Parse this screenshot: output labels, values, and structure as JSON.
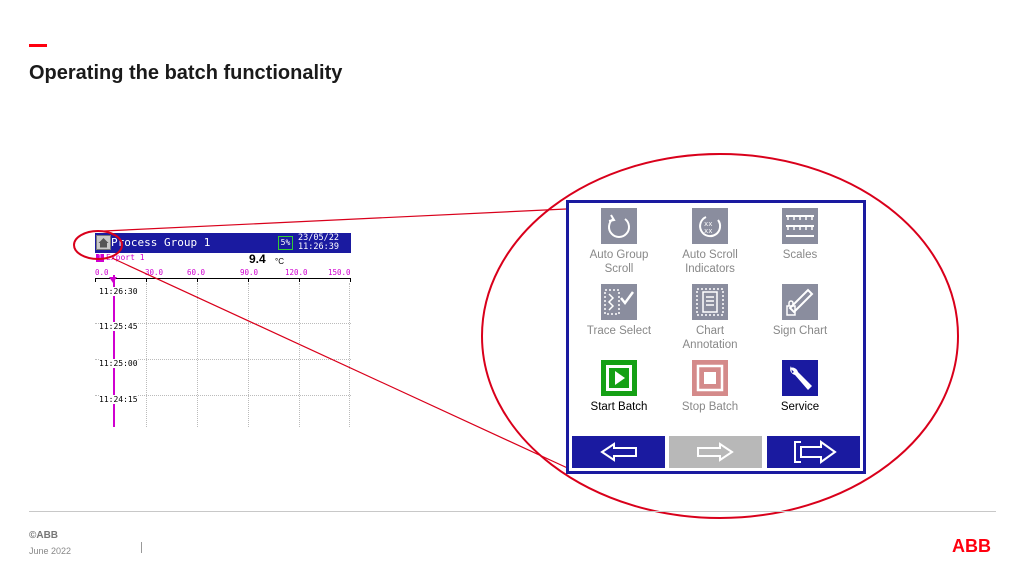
{
  "slide": {
    "title": "Operating the batch functionality",
    "accent_color": "#ff000f"
  },
  "recorder": {
    "header_title": "Process Group 1",
    "header_icon_text": "5%",
    "date": "23/05/22",
    "time": "11:26:39",
    "channel_badge": "1",
    "channel_name": "Export 1",
    "channel_value": "9.4",
    "channel_unit": "°C",
    "scale_labels": [
      "0.0",
      "30.0",
      "60.0",
      "90.0",
      "120.0",
      "150.0"
    ],
    "time_labels": [
      "11:26:30",
      "11:25:45",
      "11:25:00",
      "11:24:15"
    ],
    "header_color": "#1a1aa0",
    "trace_color": "#d000d0"
  },
  "menu": {
    "items": [
      {
        "label": "Auto Group Scroll",
        "line1": "Auto Group",
        "line2": "Scroll",
        "icon": "auto-group-scroll-icon",
        "enabled": false
      },
      {
        "label": "Auto Scroll Indicators",
        "line1": "Auto Scroll",
        "line2": "Indicators",
        "icon": "auto-scroll-indicators-icon",
        "enabled": false
      },
      {
        "label": "Scales",
        "line1": "Scales",
        "line2": "",
        "icon": "scales-icon",
        "enabled": false
      },
      {
        "label": "Trace Select",
        "line1": "Trace Select",
        "line2": "",
        "icon": "trace-select-icon",
        "enabled": false
      },
      {
        "label": "Chart Annotation",
        "line1": "Chart",
        "line2": "Annotation",
        "icon": "chart-annotation-icon",
        "enabled": false
      },
      {
        "label": "Sign Chart",
        "line1": "Sign Chart",
        "line2": "",
        "icon": "sign-chart-icon",
        "enabled": false
      },
      {
        "label": "Start Batch",
        "line1": "Start Batch",
        "line2": "",
        "icon": "start-batch-icon",
        "enabled": true
      },
      {
        "label": "Stop Batch",
        "line1": "Stop Batch",
        "line2": "",
        "icon": "stop-batch-icon",
        "enabled": false
      },
      {
        "label": "Service",
        "line1": "Service",
        "line2": "",
        "icon": "service-icon",
        "enabled": true
      }
    ],
    "nav": [
      {
        "icon": "arrow-left-icon",
        "enabled": true
      },
      {
        "icon": "arrow-right-icon",
        "enabled": false
      },
      {
        "icon": "exit-arrow-icon",
        "enabled": true
      }
    ],
    "panel_border_color": "#1a1aa0",
    "callout_color": "#d9001b"
  },
  "footer": {
    "copyright": "©ABB",
    "date": "June 2022",
    "logo": "ABB"
  }
}
